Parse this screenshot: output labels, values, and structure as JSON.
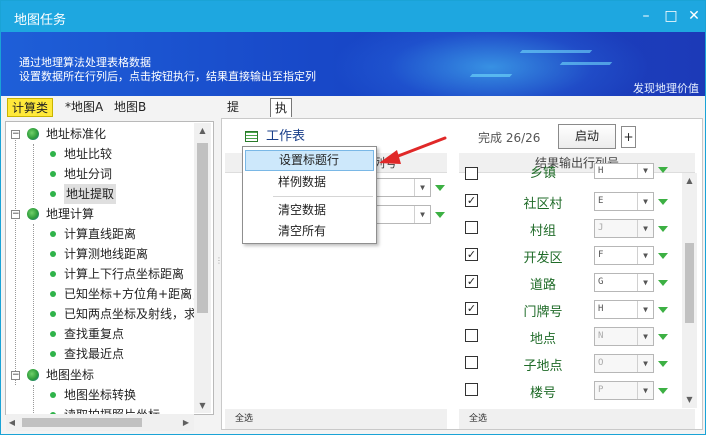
{
  "window": {
    "title": "地图任务",
    "minimize": "–",
    "maximize": "□",
    "close": "✕"
  },
  "banner": {
    "line1": "通过地理算法处理表格数据",
    "line2": "设置数据所在行列后，点击按钮执行，结果直接输出至指定列",
    "brand": "发现地理价值"
  },
  "tabs_left": [
    "计算类",
    "*地图A",
    "地图B"
  ],
  "tree": {
    "groups": [
      {
        "label": "地址标准化",
        "children": [
          "地址比较",
          "地址分词",
          "地址提取"
        ]
      },
      {
        "label": "地理计算",
        "children": [
          "计算直线距离",
          "计算测地线距离",
          "计算上下行点坐标距离",
          "已知坐标+方位角+距离，求",
          "已知两点坐标及射线，求交",
          "查找重复点",
          "查找最近点"
        ]
      },
      {
        "label": "地图坐标",
        "children": [
          "地图坐标转换",
          "读取拍摄照片坐标"
        ]
      }
    ],
    "selected": "地址提取"
  },
  "right_tabs": [
    "提示",
    "执行"
  ],
  "toolbar": {
    "worktable": "工作表",
    "done": "完成 26/26",
    "start": "启动",
    "plus": "+"
  },
  "headers": {
    "left_partial": "列号",
    "right": "结果输出行列号"
  },
  "menu": {
    "items": [
      "设置标题行",
      "样例数据",
      "清空数据",
      "清空所有"
    ]
  },
  "result_rows": [
    {
      "checked": false,
      "name": "乡镇",
      "col": "H"
    },
    {
      "checked": true,
      "name": "社区村",
      "col": "E"
    },
    {
      "checked": false,
      "name": "村组",
      "col": "J"
    },
    {
      "checked": true,
      "name": "开发区",
      "col": "F"
    },
    {
      "checked": true,
      "name": "道路",
      "col": "G"
    },
    {
      "checked": true,
      "name": "门牌号",
      "col": "H"
    },
    {
      "checked": false,
      "name": "地点",
      "col": "N"
    },
    {
      "checked": false,
      "name": "子地点",
      "col": "O"
    },
    {
      "checked": false,
      "name": "楼号",
      "col": "P"
    }
  ],
  "footer": {
    "left": "全选",
    "right": "全选"
  },
  "colors": {
    "titlebar": "#1ea7e0",
    "highlight_tab": "#ffe93a",
    "label_green": "#1f6b28",
    "arrow_red": "#e02828"
  }
}
